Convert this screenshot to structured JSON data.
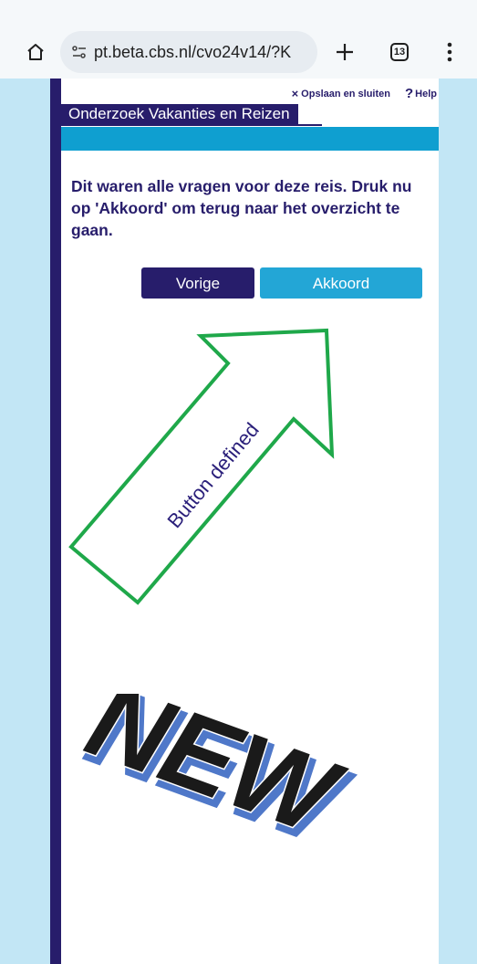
{
  "browser": {
    "url": "pt.beta.cbs.nl/cvo24v14/?K",
    "tab_count": "13"
  },
  "page": {
    "save_close_label": "Opslaan en sluiten",
    "help_label": "Help",
    "help_symbol": "?",
    "close_symbol": "×",
    "survey_title": "Onderzoek Vakanties en Reizen",
    "message": "Dit waren alle vragen voor deze reis. Druk nu op 'Akkoord' om terug naar het overzicht te gaan.",
    "prev_button": "Vorige",
    "ok_button": "Akkoord"
  },
  "annotation": {
    "arrow_text": "Button defined",
    "stamp_text": "NEW",
    "arrow_color": "#1fa84a",
    "stamp_fill": "#1a1a1a",
    "stamp_shadow": "#4f78c9"
  },
  "colors": {
    "brand_dark": "#271d6b",
    "brand_cyan": "#0f9fd0",
    "button_cyan": "#23a6d6",
    "page_bg": "#c2e6f5"
  }
}
